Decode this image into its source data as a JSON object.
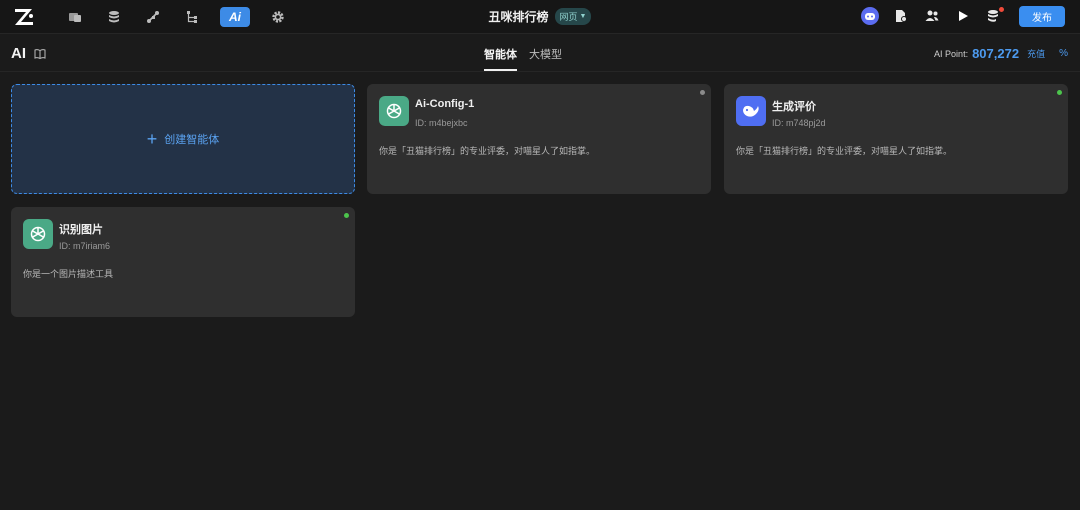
{
  "topbar": {
    "tools": [
      {
        "icon": "window-icon"
      },
      {
        "icon": "database-icon"
      },
      {
        "icon": "flow-icon"
      },
      {
        "icon": "tree-icon"
      },
      {
        "icon": "ai-icon",
        "label": "Ai",
        "active": true
      },
      {
        "icon": "gear-icon"
      }
    ],
    "app_title": "丑咪排行榜",
    "page_badge": "网页",
    "publish_label": "发布"
  },
  "subheader": {
    "section_title": "AI",
    "tabs": [
      {
        "label": "智能体",
        "active": true
      },
      {
        "label": "大模型",
        "active": false
      }
    ],
    "points_label": "AI Point:",
    "points_value": "807,272",
    "recharge_label": "充值"
  },
  "create_card": {
    "label": "创建智能体"
  },
  "agents": [
    {
      "name": "Ai-Config-1",
      "id": "ID: m4bejxbc",
      "desc": "你是「丑猫排行榜」的专业评委，对喵星人了如指掌。",
      "icon": "openai-icon",
      "avatar_color": "#4aa986",
      "status_color": "#8a8a8a"
    },
    {
      "name": "生成评价",
      "id": "ID: m748pj2d",
      "desc": "你是「丑猫排行榜」的专业评委，对喵星人了如指掌。",
      "icon": "deepseek-whale-icon",
      "avatar_color": "#4f6ef2",
      "status_color": "#4cc44c"
    },
    {
      "name": "识别图片",
      "id": "ID: m7iriam6",
      "desc": "你是一个图片描述工具",
      "icon": "openai-icon",
      "avatar_color": "#4aa986",
      "status_color": "#4cc44c"
    }
  ],
  "colors": {
    "accent": "#3a8ef0",
    "background": "#1b1b1b",
    "card": "#2f2f2f"
  }
}
